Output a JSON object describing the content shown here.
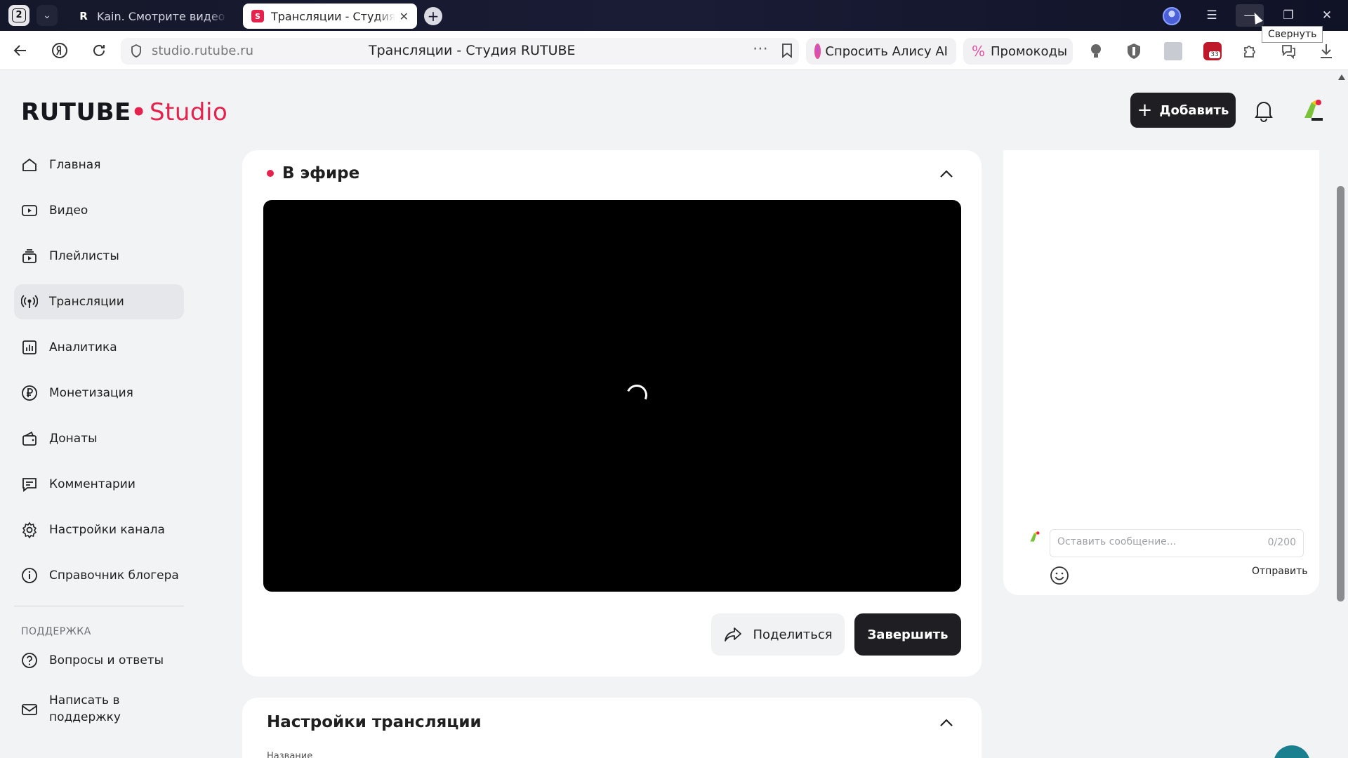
{
  "browser": {
    "tab_count": "2",
    "tabs": [
      {
        "label": "Kain. Смотрите видео онлайн",
        "favicon": "R"
      },
      {
        "label": "Трансляции - Студия RUTUBE",
        "favicon": "S"
      }
    ],
    "address": "studio.rutube.ru",
    "page_title": "Трансляции - Студия RUTUBE",
    "alice_label": "Спросить Алису AI",
    "promo_label": "Промокоды",
    "ext_badge": "33",
    "tooltip": "Свернуть"
  },
  "header": {
    "logo_main": "RUTUBE",
    "logo_studio": "Studio",
    "add_label": "Добавить"
  },
  "sidebar": {
    "items": [
      {
        "label": "Главная",
        "icon": "home-icon"
      },
      {
        "label": "Видео",
        "icon": "video-icon"
      },
      {
        "label": "Плейлисты",
        "icon": "playlist-icon"
      },
      {
        "label": "Трансляции",
        "icon": "broadcast-icon"
      },
      {
        "label": "Аналитика",
        "icon": "analytics-icon"
      },
      {
        "label": "Монетизация",
        "icon": "ruble-icon"
      },
      {
        "label": "Донаты",
        "icon": "wallet-icon"
      },
      {
        "label": "Комментарии",
        "icon": "comment-icon"
      },
      {
        "label": "Настройки канала",
        "icon": "gear-icon"
      },
      {
        "label": "Справочник блогера",
        "icon": "info-icon"
      }
    ],
    "support_heading": "ПОДДЕРЖКА",
    "support_items": [
      {
        "label": "Вопросы и ответы",
        "icon": "question-icon"
      },
      {
        "label": "Написать в поддержку",
        "icon": "mail-icon"
      }
    ]
  },
  "live": {
    "title": "В эфире",
    "share_label": "Поделиться",
    "end_label": "Завершить"
  },
  "settings": {
    "title": "Настройки трансляции",
    "field_label": "Название"
  },
  "chat": {
    "placeholder": "Оставить сообщение...",
    "counter": "0/200",
    "send_label": "Отправить"
  },
  "colors": {
    "brand": "#e5214d",
    "dark_button": "#1f1f23",
    "page_bg": "#f2f3f5"
  }
}
